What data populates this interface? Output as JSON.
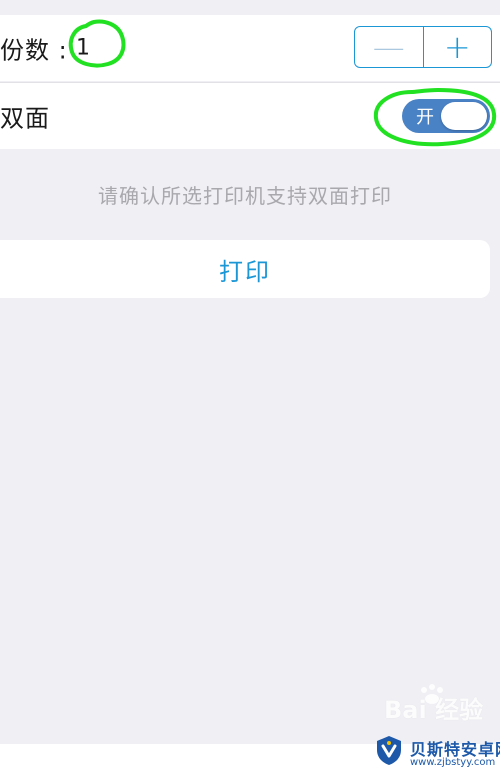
{
  "copies": {
    "label": "份数 :",
    "value": "1",
    "decrement_symbol": "—",
    "increment_symbol": "+"
  },
  "duplex": {
    "label": "双面",
    "toggle_text": "开",
    "toggle_on": true
  },
  "hint_text": "请确认所选打印机支持双面打印",
  "print_button_label": "打印",
  "watermark_text": "Bai 经验",
  "site_badge": {
    "title": "贝斯特安卓网",
    "url": "www.zjbstyy.com"
  },
  "colors": {
    "background": "#efeff4",
    "accent_blue": "#1b97d6",
    "toggle_fill": "#4a82c6",
    "annotation_green": "#22e022"
  }
}
